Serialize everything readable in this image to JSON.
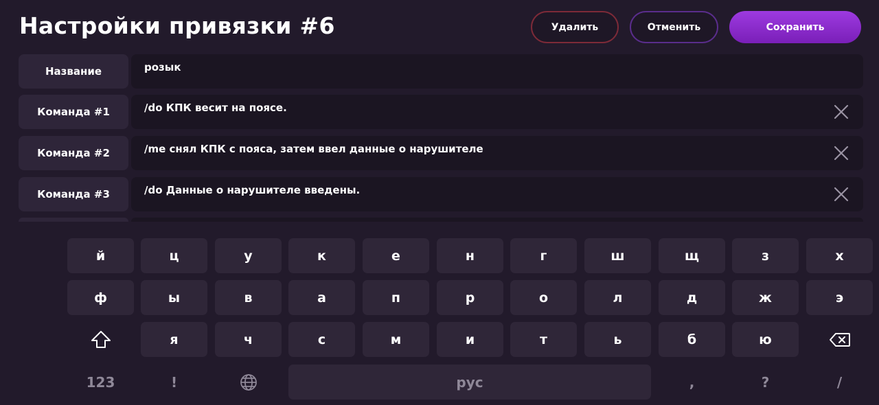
{
  "header": {
    "title": "Настройки привязки #6",
    "delete_label": "Удалить",
    "cancel_label": "Отменить",
    "save_label": "Сохранить"
  },
  "rows": [
    {
      "label": "Название",
      "value": "розык",
      "removable": false
    },
    {
      "label": "Команда #1",
      "value": "/do КПК весит на поясе.",
      "removable": true
    },
    {
      "label": "Команда #2",
      "value": "/me снял КПК с пояса, затем ввел данные о нарушителе",
      "removable": true
    },
    {
      "label": "Команда #3",
      "value": "/do Данные о нарушителе введены.",
      "removable": true
    }
  ],
  "keyboard": {
    "row1": [
      "й",
      "ц",
      "у",
      "к",
      "е",
      "н",
      "г",
      "ш",
      "щ",
      "з",
      "х"
    ],
    "row2": [
      "ф",
      "ы",
      "в",
      "а",
      "п",
      "р",
      "о",
      "л",
      "д",
      "ж",
      "э"
    ],
    "row3": [
      "я",
      "ч",
      "с",
      "м",
      "и",
      "т",
      "ь",
      "б",
      "ю"
    ],
    "numbers_label": "123",
    "exclaim_label": "!",
    "space_label": "рус",
    "comma_label": ",",
    "question_label": "?",
    "slash_label": "/",
    "icons": {
      "shift": "shift-icon",
      "backspace": "backspace-icon",
      "globe": "globe-icon",
      "remove": "close-icon"
    }
  },
  "colors": {
    "background": "#221a2b",
    "key": "#2f2638",
    "field": "#1b1522",
    "label_bg": "#2e2539",
    "delete_border": "#7d2a38",
    "cancel_border": "#5a2d8c",
    "save_accent": "#8a2bd0"
  }
}
